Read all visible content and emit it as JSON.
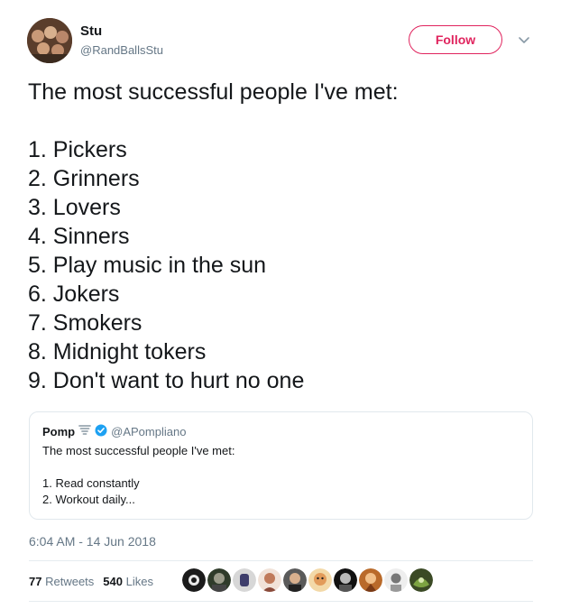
{
  "author": {
    "name": "Stu",
    "handle": "@RandBallsStu"
  },
  "follow_label": "Follow",
  "tweet_lines": [
    "The most successful people I've met:",
    "",
    "1. Pickers",
    "2. Grinners",
    "3. Lovers",
    "4. Sinners",
    "5. Play music in the sun",
    "6. Jokers",
    "7. Smokers",
    "8. Midnight tokers",
    "9. Don't want to hurt no one"
  ],
  "quote": {
    "name": "Pomp",
    "handle": "@APompliano",
    "lines": [
      "The most successful people I've met:",
      "",
      "1. Read constantly",
      "2. Workout daily..."
    ]
  },
  "timestamp": "6:04 AM - 14 Jun 2018",
  "stats": {
    "retweets_count": "77",
    "retweets_label": "Retweets",
    "likes_count": "540",
    "likes_label": "Likes"
  },
  "colors": {
    "follow": "#e0245e",
    "verified": "#1da1f2",
    "secondary_text": "#657786"
  },
  "icons": {
    "chevron": "chevron-down-icon",
    "verified": "verified-badge-icon",
    "emoji": "tornado-emoji-icon"
  }
}
